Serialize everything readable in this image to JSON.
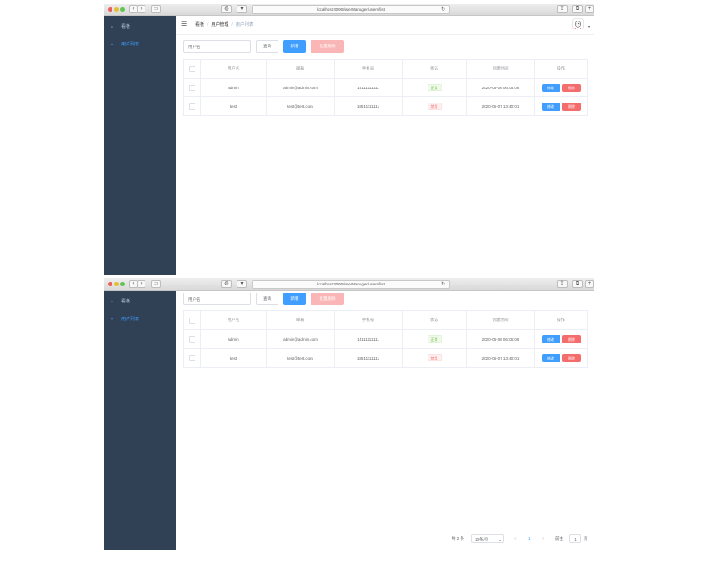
{
  "browser": {
    "url": "localhost:9090/userManager/users/list"
  },
  "sidebar": {
    "items": [
      {
        "label": "看板",
        "icon": "home-icon"
      },
      {
        "label": "用户列表",
        "icon": "user-icon"
      }
    ]
  },
  "breadcrumb": [
    "看板",
    "用户管理",
    "用户列表"
  ],
  "toolbar": {
    "search_placeholder": "用户名",
    "query_label": "查询",
    "add_label": "新增",
    "batch_delete_label": "批量删除"
  },
  "table": {
    "headers": [
      "用户名",
      "邮箱",
      "手机号",
      "状态",
      "创建时间",
      "操作"
    ],
    "rows": [
      {
        "username": "admin",
        "email": "admin@admin.com",
        "phone": "15111111111",
        "status": "正常",
        "status_type": "success",
        "created": "2020-06-06 06:06:06",
        "edit": "修改",
        "delete": "删除"
      },
      {
        "username": "test",
        "email": "test@test.com",
        "phone": "18511111111",
        "status": "禁用",
        "status_type": "danger",
        "created": "2020-06-07 13:40:01",
        "edit": "修改",
        "delete": "删除"
      }
    ]
  },
  "pagination": {
    "total_text": "共 2 条",
    "page_size": "10条/页",
    "prev": "<",
    "current_page": "1",
    "next": ">",
    "goto_label": "前往",
    "goto_value": "1",
    "page_suffix": "页"
  },
  "colors": {
    "sidebar_bg": "#304156",
    "primary": "#409eff",
    "danger": "#f56c6c",
    "success": "#67c23a"
  }
}
